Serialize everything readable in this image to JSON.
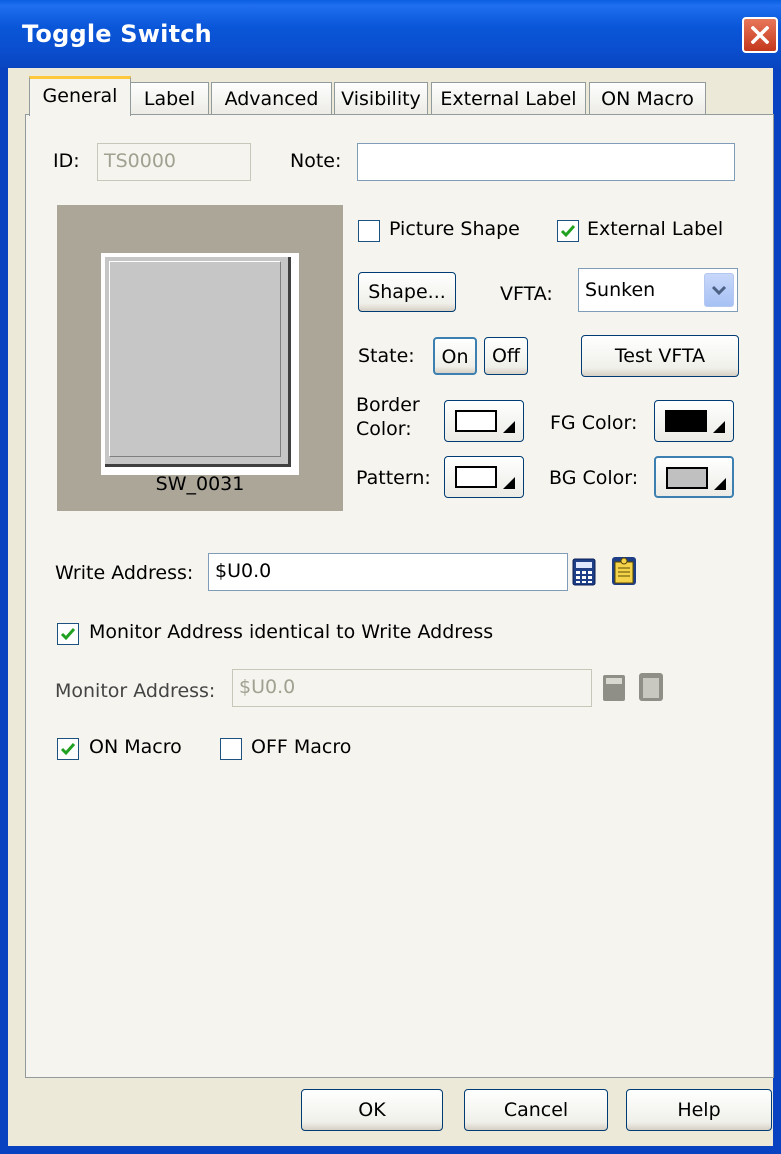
{
  "window": {
    "title": "Toggle Switch"
  },
  "tabs": [
    {
      "label": "General",
      "active": true
    },
    {
      "label": "Label"
    },
    {
      "label": "Advanced"
    },
    {
      "label": "Visibility"
    },
    {
      "label": "External Label"
    },
    {
      "label": "ON Macro"
    }
  ],
  "general": {
    "id_label": "ID:",
    "id_value": "TS0000",
    "note_label": "Note:",
    "note_value": "",
    "preview_label": "SW_0031",
    "picture_shape": {
      "label": "Picture Shape",
      "checked": false
    },
    "external_label": {
      "label": "External Label",
      "checked": true
    },
    "shape_button": "Shape...",
    "vfta_label": "VFTA:",
    "vfta_value": "Sunken",
    "state_label": "State:",
    "state_on": "On",
    "state_off": "Off",
    "test_vfta_button": "Test VFTA",
    "border_color_label_1": "Border",
    "border_color_label_2": "Color:",
    "fg_color_label": "FG Color:",
    "pattern_label": "Pattern:",
    "bg_color_label": "BG Color:",
    "colors": {
      "border": "#ffffff",
      "fg": "#000000",
      "pattern": "#ffffff",
      "bg": "#c0c0c0"
    },
    "write_address_label": "Write Address:",
    "write_address_value": "$U0.0",
    "monitor_identical": {
      "label": "Monitor Address identical to Write Address",
      "checked": true
    },
    "monitor_address_label": "Monitor Address:",
    "monitor_address_value": "$U0.0",
    "on_macro": {
      "label": "ON Macro",
      "checked": true
    },
    "off_macro": {
      "label": "OFF Macro",
      "checked": false
    }
  },
  "footer": {
    "ok": "OK",
    "cancel": "Cancel",
    "help": "Help"
  }
}
